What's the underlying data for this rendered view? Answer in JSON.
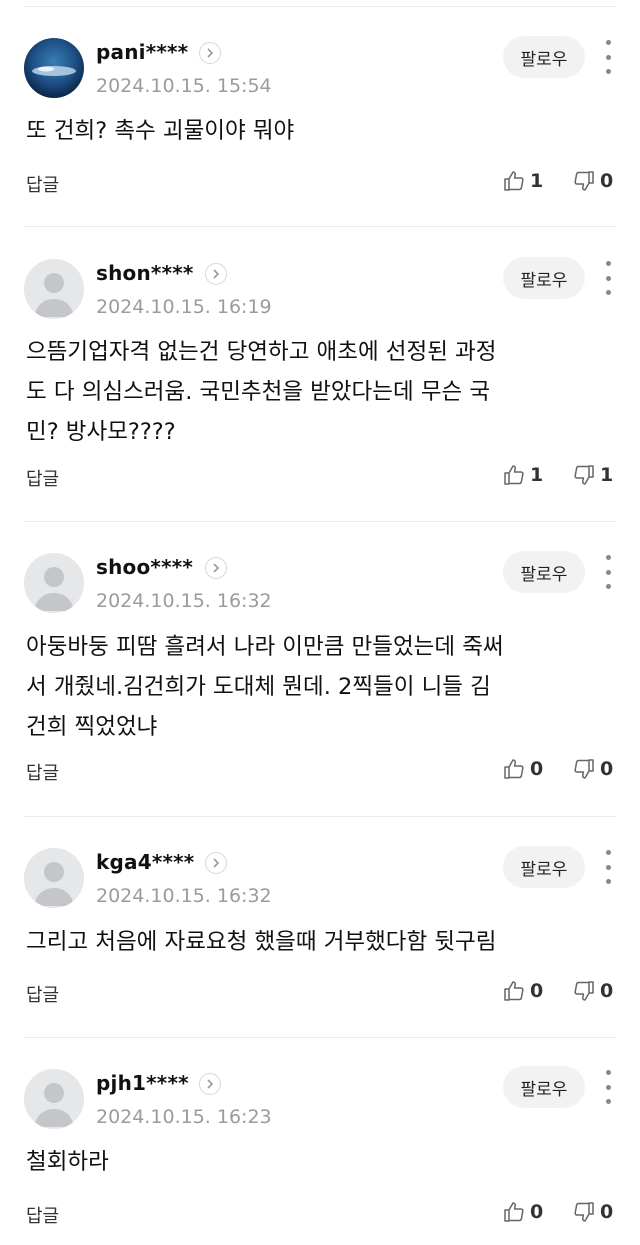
{
  "ui": {
    "follow_label": "팔로우",
    "reply_label": "답글"
  },
  "comments": [
    {
      "username": "pani****",
      "timestamp": "2024.10.15. 15:54",
      "text": "또 건희? 촉수 괴물이야 뭐야",
      "likes": "1",
      "dislikes": "0",
      "avatar": "ocean-photo-avatar"
    },
    {
      "username": "shon****",
      "timestamp": "2024.10.15. 16:19",
      "text": "으뜸기업자격 없는건 당연하고 애초에 선정된 과정\n도 다 의심스러움. 국민추천을 받았다는데 무슨 국\n민? 방사모????",
      "likes": "1",
      "dislikes": "1",
      "avatar": "default-profile-avatar"
    },
    {
      "username": "shoo****",
      "timestamp": "2024.10.15. 16:32",
      "text": "아둥바둥 피땀 흘려서 나라 이만큼 만들었는데 죽써\n서 개줬네.김건희가 도대체 뭔데. 2찍들이 니들 김\n건희 찍었었냐",
      "likes": "0",
      "dislikes": "0",
      "avatar": "default-profile-avatar"
    },
    {
      "username": "kga4****",
      "timestamp": "2024.10.15. 16:32",
      "text": "그리고 처음에 자료요청 했을때 거부했다함 뒷구림",
      "likes": "0",
      "dislikes": "0",
      "avatar": "default-profile-avatar"
    },
    {
      "username": "pjh1****",
      "timestamp": "2024.10.15. 16:23",
      "text": "철회하라",
      "likes": "0",
      "dislikes": "0",
      "avatar": "default-profile-avatar"
    }
  ]
}
